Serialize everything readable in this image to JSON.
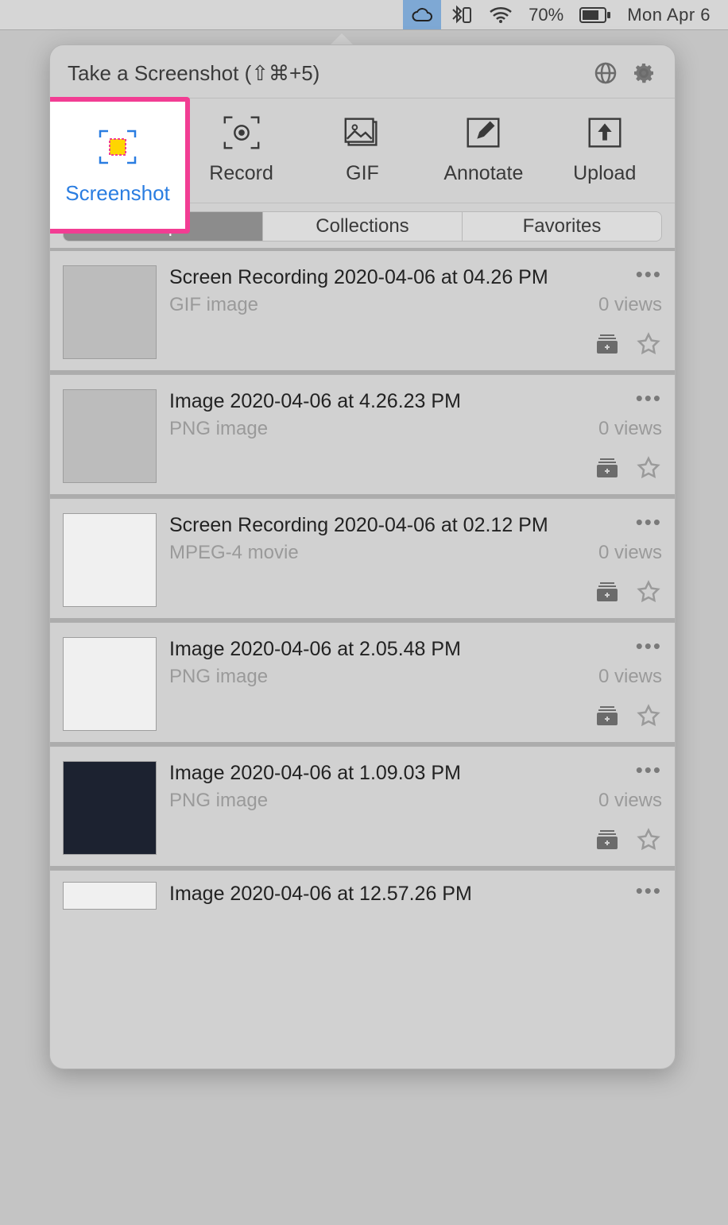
{
  "menubar": {
    "battery_percent": "70%",
    "date": "Mon Apr 6"
  },
  "panel": {
    "title": "Take a Screenshot (⇧⌘+5)"
  },
  "actions": [
    {
      "label": "Screenshot",
      "selected": true
    },
    {
      "label": "Record"
    },
    {
      "label": "GIF"
    },
    {
      "label": "Annotate"
    },
    {
      "label": "Upload"
    }
  ],
  "tabs": [
    {
      "label": "Drops",
      "active": true
    },
    {
      "label": "Collections"
    },
    {
      "label": "Favorites"
    }
  ],
  "items": [
    {
      "title": "Screen Recording 2020-04-06 at 04.26 PM",
      "type": "GIF image",
      "views": "0 views",
      "thumb": "gray"
    },
    {
      "title": "Image 2020-04-06 at 4.26.23 PM",
      "type": "PNG image",
      "views": "0 views",
      "thumb": "gray"
    },
    {
      "title": "Screen Recording 2020-04-06 at 02.12 PM",
      "type": "MPEG-4 movie",
      "views": "0 views",
      "thumb": "page"
    },
    {
      "title": "Image 2020-04-06 at 2.05.48 PM",
      "type": "PNG image",
      "views": "0 views",
      "thumb": "page"
    },
    {
      "title": "Image 2020-04-06 at 1.09.03 PM",
      "type": "PNG image",
      "views": "0 views",
      "thumb": "dark"
    },
    {
      "title": "Image 2020-04-06 at 12.57.26 PM",
      "type": "",
      "views": "",
      "thumb": "page"
    }
  ]
}
